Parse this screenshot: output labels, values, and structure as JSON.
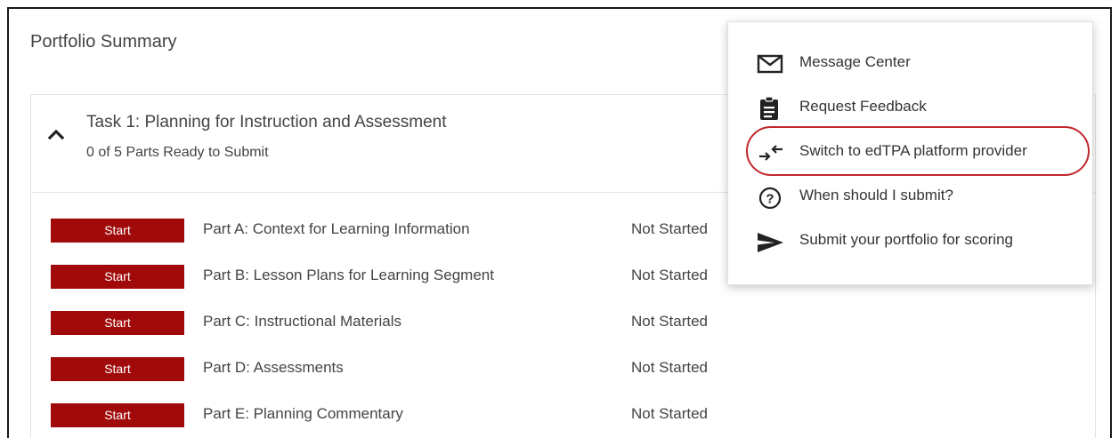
{
  "page": {
    "title": "Portfolio Summary",
    "accent_color": "#a10a0a"
  },
  "task": {
    "title": "Task 1: Planning for Instruction and Assessment",
    "subtitle": "0 of 5 Parts Ready to Submit",
    "parts": [
      {
        "button": "Start",
        "label": "Part A: Context for Learning Information",
        "status": "Not Started"
      },
      {
        "button": "Start",
        "label": "Part B: Lesson Plans for Learning Segment",
        "status": "Not Started"
      },
      {
        "button": "Start",
        "label": "Part C: Instructional Materials",
        "status": "Not Started"
      },
      {
        "button": "Start",
        "label": "Part D: Assessments",
        "status": "Not Started"
      },
      {
        "button": "Start",
        "label": "Part E: Planning Commentary",
        "status": "Not Started"
      }
    ]
  },
  "menu": {
    "items": [
      {
        "icon": "envelope-icon",
        "label": "Message Center"
      },
      {
        "icon": "clipboard-icon",
        "label": "Request Feedback"
      },
      {
        "icon": "switch-arrows-icon",
        "label": "Switch to edTPA platform provider"
      },
      {
        "icon": "question-circle-icon",
        "label": "When should I submit?"
      },
      {
        "icon": "send-icon",
        "label": "Submit your portfolio for scoring"
      }
    ]
  }
}
